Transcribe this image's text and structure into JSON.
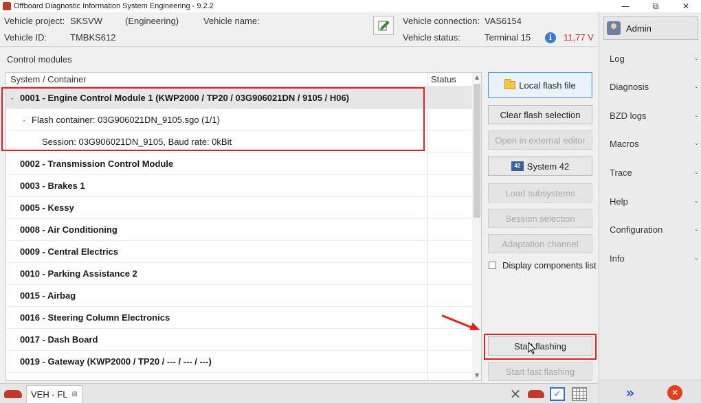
{
  "window": {
    "title": "Offboard Diagnostic Information System Engineering - 9.2.2",
    "minimize": "—",
    "restore": "⧉",
    "close": "✕"
  },
  "header": {
    "project_label": "Vehicle project:",
    "project_value": "SKSVW",
    "project_mode": "(Engineering)",
    "vehicle_name_label": "Vehicle name:",
    "vehicle_id_label": "Vehicle ID:",
    "vehicle_id_value": "TMBKS612",
    "connection_label": "Vehicle connection:",
    "connection_value": "VAS6154",
    "status_label": "Vehicle status:",
    "status_value": "Terminal 15",
    "voltage": "11,77 V",
    "info_glyph": "i"
  },
  "sidebar": {
    "admin_label": "Admin",
    "items": [
      {
        "label": "Log"
      },
      {
        "label": "Diagnosis"
      },
      {
        "label": "BZD logs"
      },
      {
        "label": "Macros"
      },
      {
        "label": "Trace"
      },
      {
        "label": "Help"
      },
      {
        "label": "Configuration"
      },
      {
        "label": "Info"
      }
    ],
    "chevron": "⌄"
  },
  "control_modules": {
    "label": "Control modules",
    "col_system": "System / Container",
    "col_status": "Status",
    "rows": [
      {
        "text": "0001 - Engine Control Module 1  (KWP2000 / TP20 / 03G906021DN / 9105 / H06)",
        "bold": true,
        "expanded": true
      },
      {
        "text": "Flash container: 03G906021DN_9105.sgo (1/1)",
        "bold": false,
        "expanded": true
      },
      {
        "text": "Session: 03G906021DN_9105, Baud rate: 0kBit",
        "bold": false
      },
      {
        "text": "0002 - Transmission Control Module",
        "bold": true
      },
      {
        "text": "0003 - Brakes 1",
        "bold": true
      },
      {
        "text": "0005 - Kessy",
        "bold": true
      },
      {
        "text": "0008 - Air Conditioning",
        "bold": true
      },
      {
        "text": "0009 - Central Electrics",
        "bold": true
      },
      {
        "text": "0010 - Parking Assistance 2",
        "bold": true
      },
      {
        "text": "0015 - Airbag",
        "bold": true
      },
      {
        "text": "0016 - Steering Column Electronics",
        "bold": true
      },
      {
        "text": "0017 - Dash Board",
        "bold": true
      },
      {
        "text": "0019 - Gateway  (KWP2000 / TP20 / --- / --- / ---)",
        "bold": true
      }
    ],
    "chevron_expanded": "⌄"
  },
  "actions": {
    "local_flash_file": "Local flash file",
    "clear_flash_selection": "Clear flash selection",
    "open_external_editor": "Open in external editor",
    "system42": "System 42",
    "load_subsystems": "Load subsystems",
    "session_selection": "Session selection",
    "adaptation_channel": "Adaptation channel",
    "display_components_list": "Display components list",
    "start_flashing": "Start flashing",
    "start_fast_flashing": "Start fast flashing"
  },
  "tabbar": {
    "tab_label": "VEH - FL",
    "tab_close": "⊠"
  },
  "colors": {
    "highlight_red": "#e02020",
    "voltage_red": "#d03030",
    "accent_blue": "#3a6fc4"
  }
}
